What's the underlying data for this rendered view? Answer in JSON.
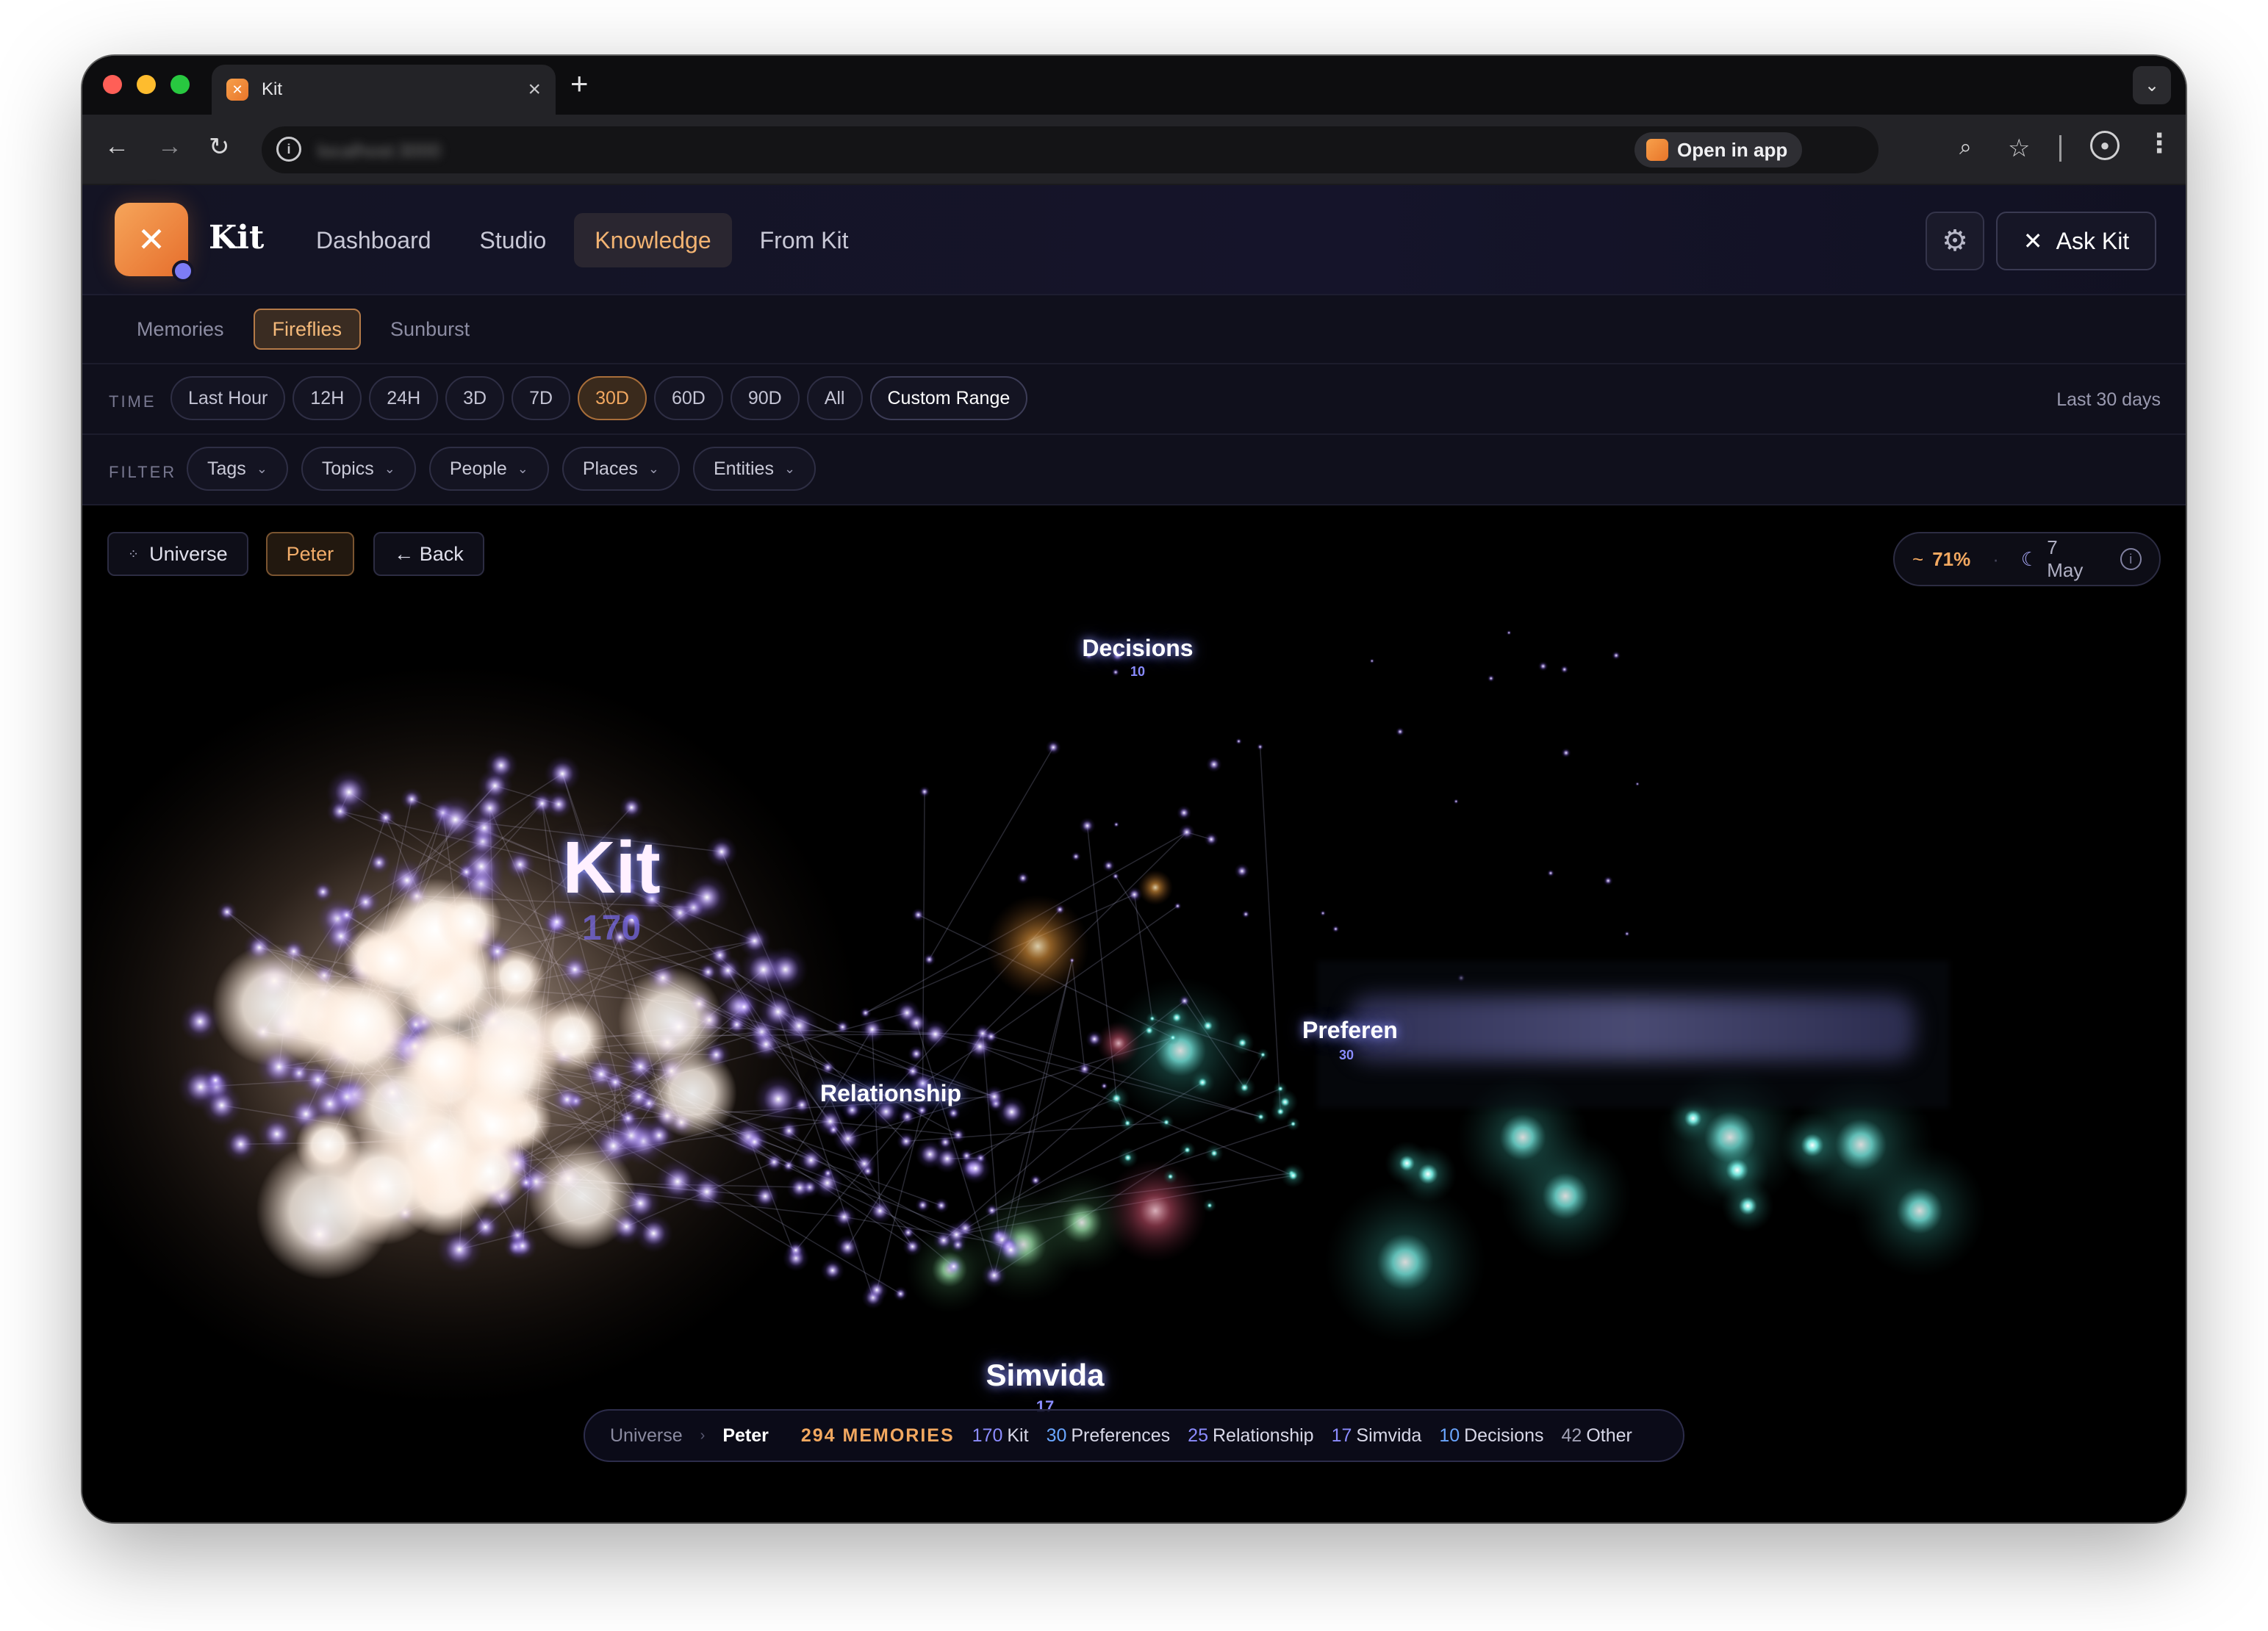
{
  "browser": {
    "tab_title": "Kit",
    "tab_close": "×",
    "new_tab": "+",
    "url": "localhost:3000",
    "open_in_app": "Open in app"
  },
  "app": {
    "brand": "Kit",
    "nav": [
      "Dashboard",
      "Studio",
      "Knowledge",
      "From Kit"
    ],
    "nav_active": "Knowledge",
    "ask_label": "Ask Kit",
    "subtabs": [
      "Memories",
      "Fireflies",
      "Sunburst"
    ],
    "subtab_active": "Fireflies"
  },
  "time_filter": {
    "label": "TIME",
    "options": [
      "Last Hour",
      "12H",
      "24H",
      "3D",
      "7D",
      "30D",
      "60D",
      "90D",
      "All"
    ],
    "active": "30D",
    "custom": "Custom Range",
    "summary": "Last 30 days"
  },
  "filter": {
    "label": "FILTER",
    "options": [
      "Tags",
      "Topics",
      "People",
      "Places",
      "Entities"
    ]
  },
  "viz": {
    "universe_btn": "Universe",
    "peter_btn": "Peter",
    "back_btn": "← Back",
    "status": {
      "approx": "~",
      "percent": "71%",
      "dot": "·",
      "moon": "☾",
      "date": "7 May",
      "info": "i"
    },
    "clusters": [
      {
        "name": "Kit",
        "count": "170"
      },
      {
        "name": "Decisions",
        "count": "10"
      },
      {
        "name": "Relationship",
        "count": ""
      },
      {
        "name": "Preferen",
        "count": "30"
      },
      {
        "name": "Simvida",
        "count": "17"
      }
    ],
    "colors": {
      "kit": "#ffd9b8",
      "violet": "#a88cff",
      "teal": "#5ef0e6",
      "green": "#9ef0b0"
    }
  },
  "breadcrumb": {
    "universe": "Universe",
    "sep": "›",
    "peter": "Peter",
    "memories": "294 MEMORIES",
    "items": [
      {
        "num": "170",
        "label": "Kit"
      },
      {
        "num": "30",
        "label": "Preferences"
      },
      {
        "num": "25",
        "label": "Relationship"
      },
      {
        "num": "17",
        "label": "Simvida"
      },
      {
        "num": "10",
        "label": "Decisions"
      },
      {
        "num": "42",
        "label": "Other"
      }
    ]
  }
}
